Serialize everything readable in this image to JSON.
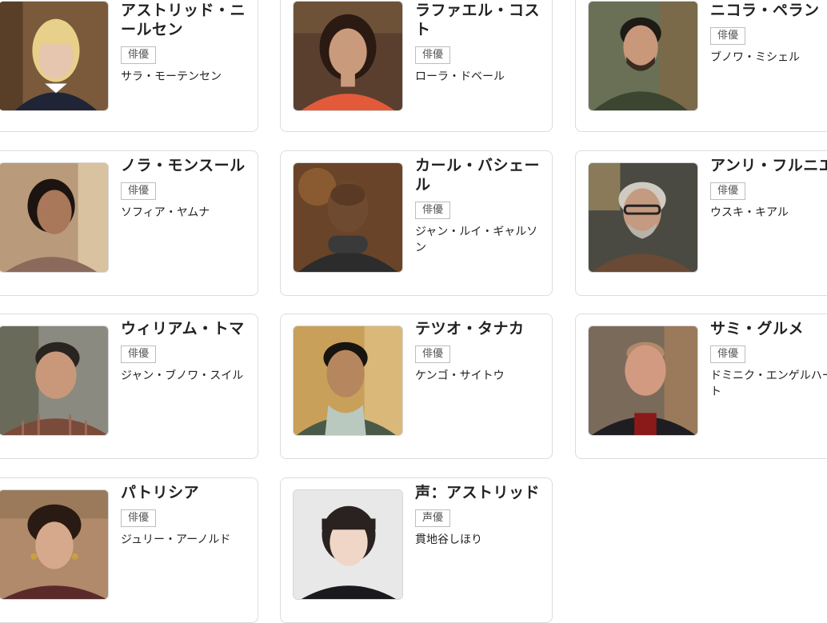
{
  "cast": [
    {
      "character": "アストリッド・ニールセン",
      "role": "俳優",
      "actor": "サラ・モーテンセン",
      "photo_colors": {
        "bg": "#7a5a3a",
        "skin": "#e7c6b0",
        "hair": "#e6d08a",
        "cloth": "#1f2436"
      }
    },
    {
      "character": "ラファエル・コスト",
      "role": "俳優",
      "actor": "ローラ・ドベール",
      "photo_colors": {
        "bg": "#5a3f2e",
        "skin": "#c99a7c",
        "hair": "#2a1a12",
        "cloth": "#e35a3a"
      }
    },
    {
      "character": "ニコラ・ペラン",
      "role": "俳優",
      "actor": "ブノワ・ミシェル",
      "photo_colors": {
        "bg": "#6a7055",
        "skin": "#c9977a",
        "hair": "#1e1a16",
        "cloth": "#3b4530"
      }
    },
    {
      "character": "ノラ・モンスール",
      "role": "俳優",
      "actor": "ソフィア・ヤムナ",
      "photo_colors": {
        "bg": "#b99a7a",
        "skin": "#a9775a",
        "hair": "#1c1410",
        "cloth": "#8a6a5a"
      }
    },
    {
      "character": "カール・バシェール",
      "role": "俳優",
      "actor": "ジャン・ルイ・ギャルソン",
      "photo_colors": {
        "bg": "#6a4428",
        "skin": "#6e4a30",
        "hair": "#5a3a24",
        "cloth": "#2c2c2c"
      }
    },
    {
      "character": "アンリ・フルニエ",
      "role": "俳優",
      "actor": "ウスキ・キアル",
      "photo_colors": {
        "bg": "#4a4a42",
        "skin": "#c49a80",
        "hair": "#cfcac2",
        "cloth": "#6a4a34"
      }
    },
    {
      "character": "ウィリアム・トマ",
      "role": "俳優",
      "actor": "ジャン・ブノワ・スイル",
      "photo_colors": {
        "bg": "#8a8a80",
        "skin": "#c9987a",
        "hair": "#2a2420",
        "cloth": "#7a4a3a"
      }
    },
    {
      "character": "テツオ・タナカ",
      "role": "俳優",
      "actor": "ケンゴ・サイトウ",
      "photo_colors": {
        "bg": "#c9a05a",
        "skin": "#b6875e",
        "hair": "#181410",
        "cloth": "#4a5a48"
      }
    },
    {
      "character": "サミ・グルメ",
      "role": "俳優",
      "actor": "ドミニク・エンゲルハート",
      "photo_colors": {
        "bg": "#7a6a5a",
        "skin": "#d39a82",
        "hair": "#b08a6a",
        "cloth": "#1e1e22"
      }
    },
    {
      "character": "パトリシア",
      "role": "俳優",
      "actor": "ジュリー・アーノルド",
      "photo_colors": {
        "bg": "#b08a6a",
        "skin": "#d7a98c",
        "hair": "#2a1a14",
        "cloth": "#5a2a2a"
      }
    },
    {
      "character": "声：アストリッド",
      "role": "声優",
      "actor": "貫地谷しほり",
      "photo_colors": {
        "bg": "#e8e8e8",
        "skin": "#efd6c6",
        "hair": "#2a2220",
        "cloth": "#1a1a1e"
      }
    }
  ]
}
